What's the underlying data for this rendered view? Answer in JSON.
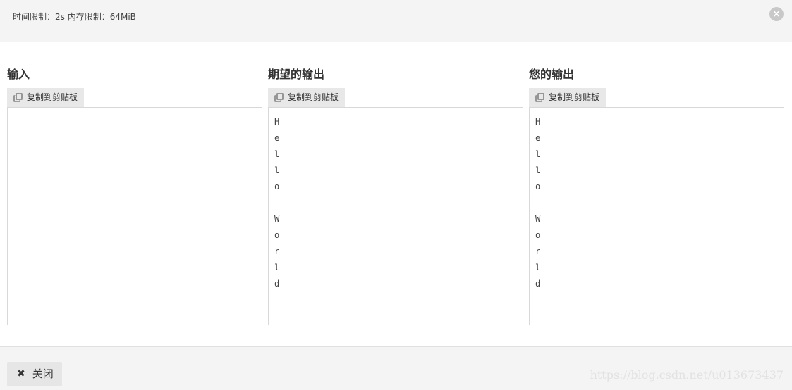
{
  "header": {
    "limits_text": "时间限制：2s 内存限制：64MiB",
    "close_icon": "×"
  },
  "columns": [
    {
      "title": "输入",
      "copy_label": "复制到剪贴板",
      "content": ""
    },
    {
      "title": "期望的输出",
      "copy_label": "复制到剪贴板",
      "content": "H\ne\nl\nl\no\n\nW\no\nr\nl\nd"
    },
    {
      "title": "您的输出",
      "copy_label": "复制到剪贴板",
      "content": "H\ne\nl\nl\no\n\nW\no\nr\nl\nd"
    }
  ],
  "footer": {
    "close_icon": "✖",
    "close_label": "关闭",
    "watermark": "https://blog.csdn.net/u013673437"
  }
}
